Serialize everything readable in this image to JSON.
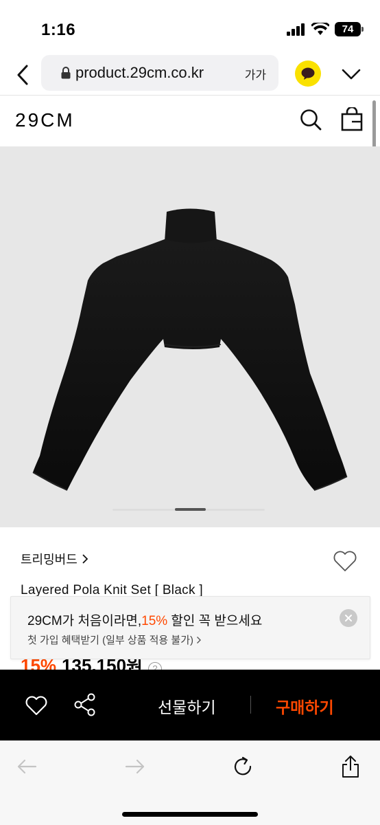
{
  "status_bar": {
    "time": "1:16",
    "battery": "74"
  },
  "browser": {
    "url": "product.29cm.co.kr",
    "text_size_label": "가가",
    "icons": [
      "back-icon",
      "lock-icon",
      "kakao-talk-icon",
      "chevron-down-icon"
    ]
  },
  "site": {
    "logo": "29CM",
    "icons": [
      "search-icon",
      "shopping-bag-icon"
    ]
  },
  "product": {
    "brand": "트리밍버드",
    "name": "Layered Pola Knit Set [ Black ]",
    "discount": "15%",
    "price": "135,150원",
    "info_glyph": "?",
    "image_count_indicator": "carousel"
  },
  "promo": {
    "title_prefix": "29CM가 처음이라면,",
    "title_accent": "15%",
    "title_suffix": " 할인 꼭 받으세요",
    "subtitle": "첫 가입 혜택받기 (일부 상품 적용 불가)"
  },
  "buy_bar": {
    "gift_label": "선물하기",
    "buy_label": "구매하기"
  },
  "colors": {
    "accent": "#ff4800",
    "kakao": "#fae100",
    "image_bg": "#e7e7e7",
    "buy_bar_bg": "#000000"
  }
}
